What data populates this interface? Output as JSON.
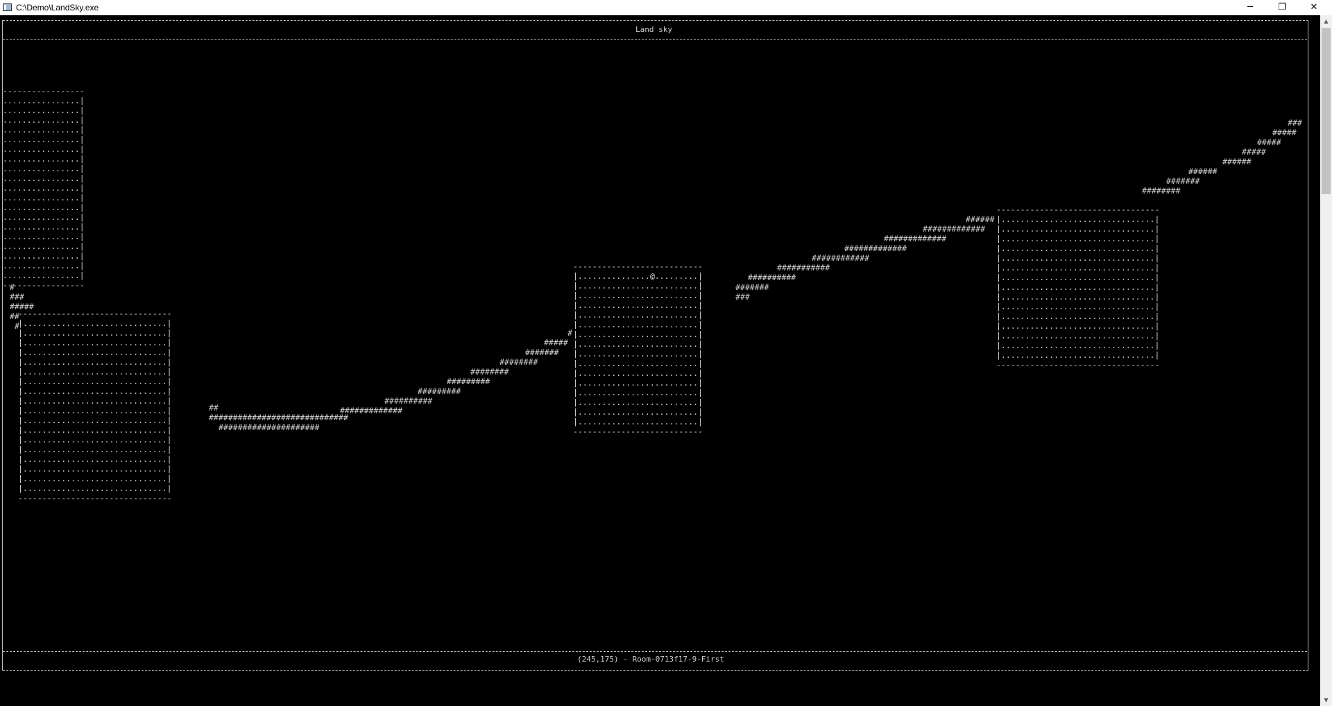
{
  "window": {
    "title": "C:\\Demo\\LandSky.exe",
    "minimize_glyph": "─",
    "restore_glyph": "❐",
    "close_glyph": "✕"
  },
  "scrollbar": {
    "up_glyph": "▲",
    "down_glyph": "▼"
  },
  "console": {
    "header_title": "Land sky",
    "status_text": "(245,175) - Room-0713f17-9-First",
    "player_glyph": "@",
    "floor_glyph": ".",
    "corridor_glyph": "#"
  }
}
